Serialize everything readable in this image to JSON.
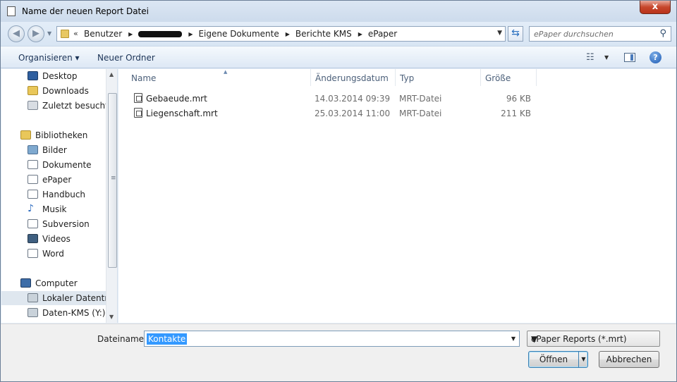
{
  "window": {
    "title": "Name der neuen Report Datei",
    "close_glyph": "x"
  },
  "address": {
    "overflow": "«",
    "crumbs": [
      "Benutzer",
      "Eigene Dokumente",
      "Berichte KMS",
      "ePaper"
    ],
    "search_placeholder": "ePaper durchsuchen"
  },
  "toolbar": {
    "organize_label": "Organisieren ▾",
    "new_folder_label": "Neuer Ordner",
    "help_glyph": "?"
  },
  "sidebar": {
    "favorites": [
      {
        "label": "Desktop",
        "icon": "desktop-icon"
      },
      {
        "label": "Downloads",
        "icon": "downloads-icon"
      },
      {
        "label": "Zuletzt besucht",
        "icon": "recent-places-icon"
      }
    ],
    "libraries": {
      "label": "Bibliotheken",
      "items": [
        {
          "label": "Bilder",
          "icon": "pictures-icon"
        },
        {
          "label": "Dokumente",
          "icon": "documents-icon"
        },
        {
          "label": "ePaper",
          "icon": "library-icon"
        },
        {
          "label": "Handbuch",
          "icon": "library-icon"
        },
        {
          "label": "Musik",
          "icon": "music-icon"
        },
        {
          "label": "Subversion",
          "icon": "library-icon"
        },
        {
          "label": "Videos",
          "icon": "videos-icon"
        },
        {
          "label": "Word",
          "icon": "library-icon"
        }
      ]
    },
    "computer": {
      "label": "Computer",
      "items": [
        {
          "label": "Lokaler Datenträger (C:)",
          "icon": "local-disk-icon"
        },
        {
          "label": "Daten-KMS (Y:)",
          "icon": "network-drive-icon"
        }
      ]
    }
  },
  "columns": [
    "Name",
    "Änderungsdatum",
    "Typ",
    "Größe"
  ],
  "files": [
    {
      "name": "Gebaeude.mrt",
      "modified": "14.03.2014 09:39",
      "type": "MRT-Datei",
      "size": "96 KB"
    },
    {
      "name": "Liegenschaft.mrt",
      "modified": "25.03.2014 11:00",
      "type": "MRT-Datei",
      "size": "211 KB"
    }
  ],
  "footer": {
    "filename_label": "Dateiname:",
    "filename_value": "Kontakte",
    "filter_value": "ePaper Reports (*.mrt)",
    "open_label": "Öffnen",
    "cancel_label": "Abbrechen"
  },
  "colors": {
    "window_bg": "#e5eef8",
    "selection": "#3399ff",
    "close_button": "#c7462c"
  }
}
